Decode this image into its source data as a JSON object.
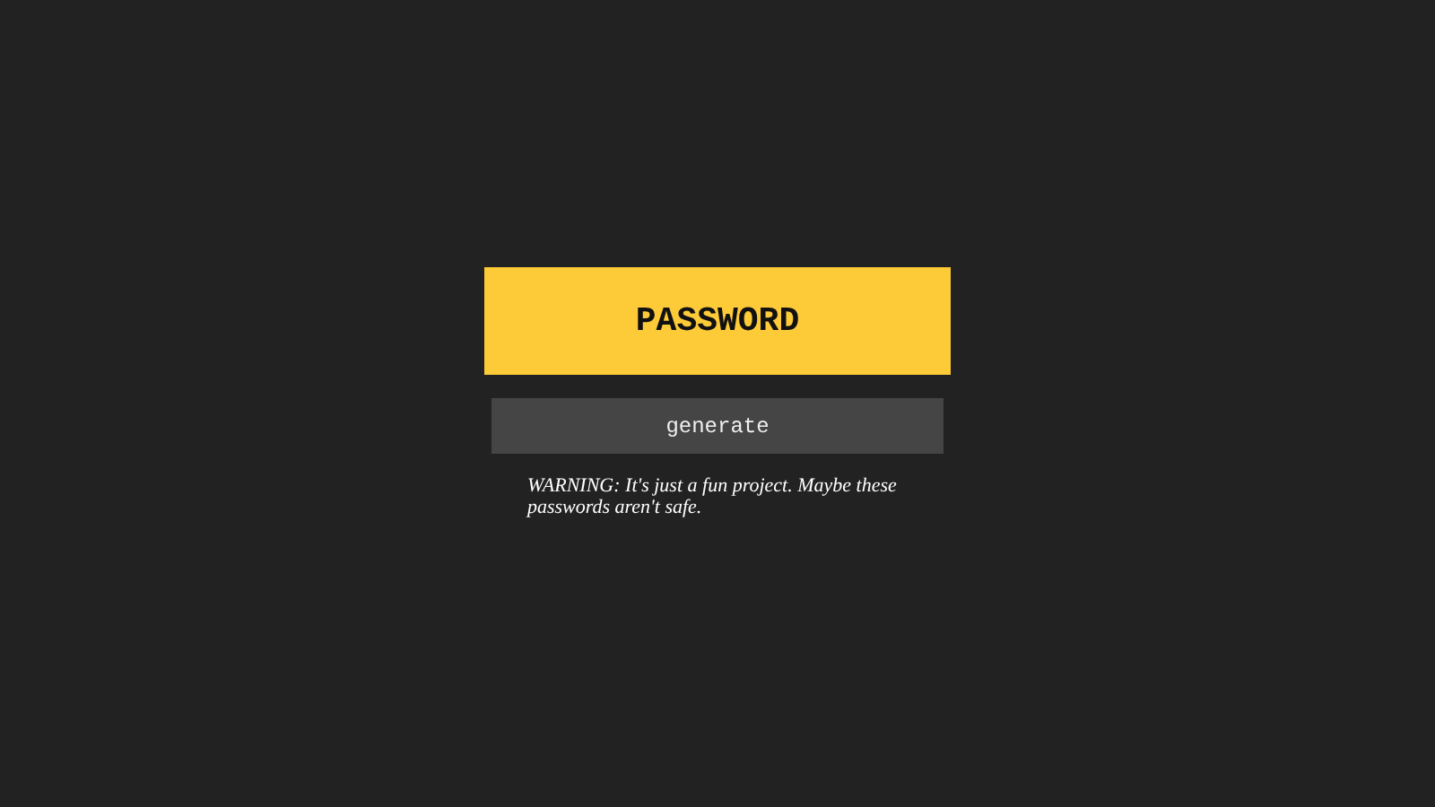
{
  "password_display": {
    "text": "PASSWORD"
  },
  "generate_button": {
    "label": "generate"
  },
  "warning": "WARNING: It's just a fun project. Maybe these passwords aren't safe."
}
